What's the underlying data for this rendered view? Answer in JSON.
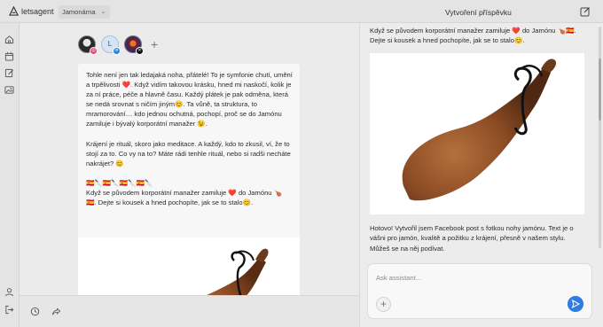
{
  "app": {
    "brand_name": "letsagent",
    "workspace": "Jamonárna"
  },
  "header": {
    "panel_title": "Vytvoření příspěvku"
  },
  "sidebar": {
    "items": [
      {
        "icon": "home-icon"
      },
      {
        "icon": "calendar-icon"
      },
      {
        "icon": "edit-post-icon"
      },
      {
        "icon": "image-gallery-icon"
      }
    ],
    "bottom": [
      {
        "icon": "user-icon"
      },
      {
        "icon": "logout-icon"
      }
    ]
  },
  "accounts": [
    {
      "avatar": "avatar-photo",
      "network": "instagram"
    },
    {
      "avatar": "avatar-L",
      "initial": "L",
      "network": "linkedin"
    },
    {
      "avatar": "avatar-logo",
      "network": "x"
    }
  ],
  "post": {
    "paragraphs": [
      "Tohle není jen tak ledajaká noha, přátelé! To je symfonie chutí, umění a trpělivosti ❤️. Když vidím takovou krásku, hned mi naskočí, kolik je za ní práce, péče a hlavně času. Každý plátek je pak odměna, která se nedá srovnat s ničím jiným😊. Ta vůně, ta struktura, to mramorování… kdo jednou ochutná, pochopí, proč se do Jamónu zamiluje i bývalý korporátní manažer 😉.",
      "Krájení je rituál, skoro jako meditace. A každý, kdo to zkusil, ví, že to stojí za to. Co vy na to? Máte rádi tenhle rituál, nebo si radši necháte nakrájet? 😊",
      "🇪🇸🔪🇪🇸🔪🇪🇸🔪🇪🇸🔪\nKdyž se původem korporátní manažer zamiluje ❤️ do Jamónu 🍗 🇪🇸. Dejte si kousek a hned pochopíte, jak se to stalo😊."
    ]
  },
  "chat": {
    "top_message": "Když se původem korporátní manažer zamiluje ❤️ do Jamónu 🍗🇪🇸. Dejte si kousek a hned pochopíte, jak se to stalo😊.",
    "reply": "Hotovo! Vytvořil jsem Facebook post s fotkou nohy jamónu. Text je o vášni pro jamón, kvalitě a požitku z krájení, přesně v našem stylu. Můžeš se na něj podívat.",
    "input_placeholder": "Ask assistant...",
    "input_value": ""
  },
  "colors": {
    "accent": "#2f7de1",
    "heart": "#e03a3a"
  }
}
